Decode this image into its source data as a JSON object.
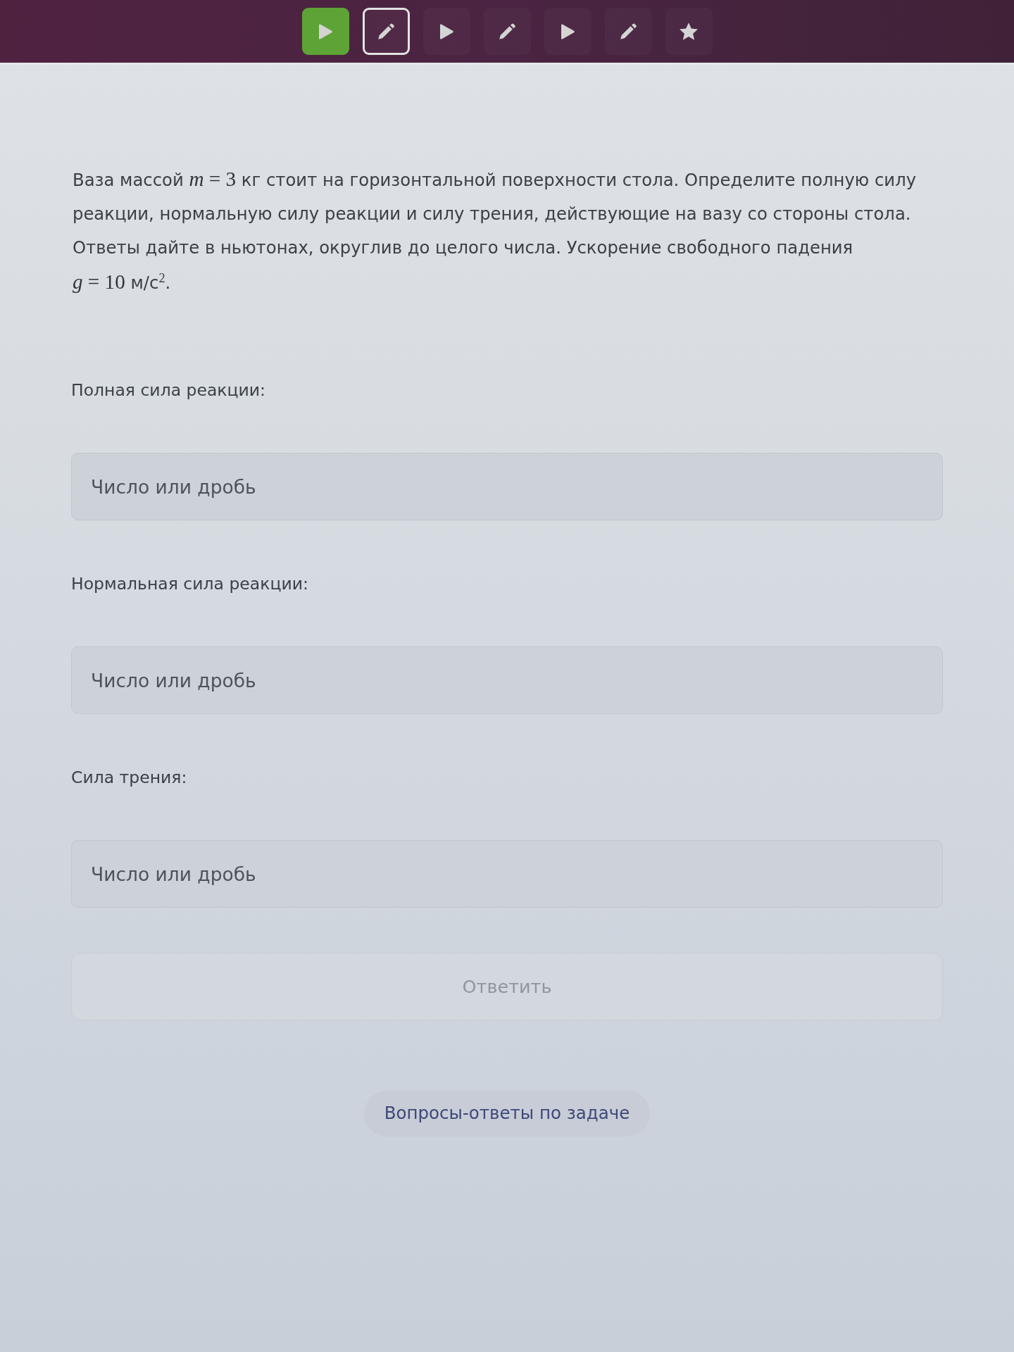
{
  "toolbar": {
    "steps": [
      {
        "kind": "play",
        "solved": true,
        "selected": false
      },
      {
        "kind": "pencil",
        "solved": false,
        "selected": true
      },
      {
        "kind": "play",
        "solved": false,
        "selected": false
      },
      {
        "kind": "pencil",
        "solved": false,
        "selected": false
      },
      {
        "kind": "play",
        "solved": false,
        "selected": false
      },
      {
        "kind": "pencil",
        "solved": false,
        "selected": false
      },
      {
        "kind": "star",
        "solved": false,
        "selected": false
      }
    ]
  },
  "problem": {
    "segments": [
      {
        "kind": "text",
        "text": "Ваза массой "
      },
      {
        "kind": "math",
        "text": "*m* = 3"
      },
      {
        "kind": "text",
        "text": " кг стоит на горизонтальной поверхности стола. Определите полную силу реакции, нормальную силу реакции и силу трения, действующие на вазу со стороны стола. Ответы дайте в ньютонах, округлив до целого числа. Ускорение свободного падения "
      },
      {
        "kind": "math",
        "text": "*g* = 10"
      },
      {
        "kind": "unit",
        "text": " м/с$^{2}$."
      }
    ]
  },
  "answers": [
    {
      "label": "Полная сила реакции:",
      "placeholder": "Число или дробь"
    },
    {
      "label": "Нормальная сила реакции:",
      "placeholder": "Число или дробь"
    },
    {
      "label": "Сила трения:",
      "placeholder": "Число или дробь"
    }
  ],
  "submit_button": {
    "label": "Ответить",
    "disabled": true
  },
  "discussion_button": {
    "label": "Вопросы-ответы по задаче"
  }
}
